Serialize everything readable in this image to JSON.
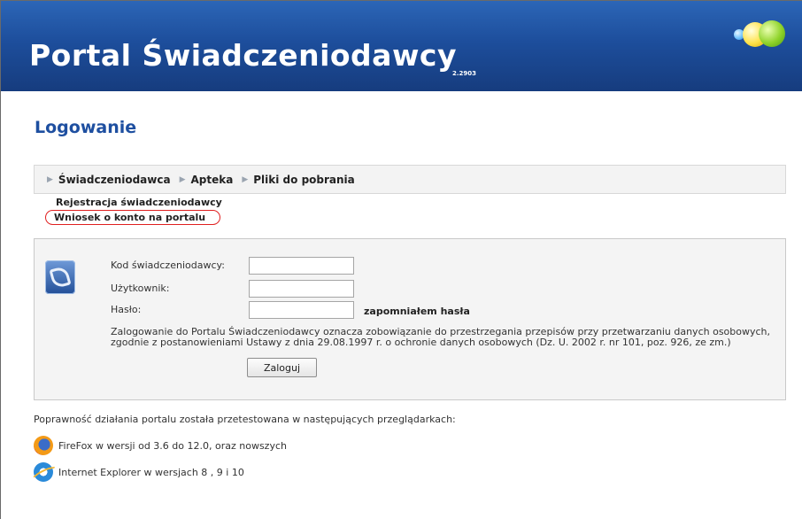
{
  "header": {
    "title": "Portal Świadczeniodawcy",
    "version": "2.2903"
  },
  "page": {
    "heading": "Logowanie"
  },
  "nav": {
    "items": [
      {
        "label": "Świadczeniodawca"
      },
      {
        "label": "Apteka"
      },
      {
        "label": "Pliki do pobrania"
      }
    ],
    "submenu": [
      {
        "label": "Rejestracja świadczeniodawcy"
      },
      {
        "label": "Wniosek o konto na portalu"
      }
    ]
  },
  "login": {
    "code_label": "Kod świadczeniodawcy:",
    "code_value": "",
    "user_label": "Użytkownik:",
    "user_value": "",
    "password_label": "Hasło:",
    "password_value": "",
    "forgot_label": "zapomniałem hasła",
    "legal_text": "Zalogowanie do Portalu Świadczeniodawcy oznacza zobowiązanie do przestrzegania przepisów przy przetwarzaniu danych osobowych, zgodnie z postanowieniami Ustawy z dnia 29.08.1997 r. o ochronie danych osobowych (Dz. U. 2002 r. nr 101, poz. 926, ze zm.)",
    "submit_label": "Zaloguj"
  },
  "browsers": {
    "intro": "Poprawność działania portalu została przetestowana w następujących przeglądarkach:",
    "items": [
      {
        "icon": "firefox-icon",
        "text": "FireFox w wersji od 3.6 do 12.0, oraz nowszych"
      },
      {
        "icon": "internet-explorer-icon",
        "text": "Internet Explorer w wersjach 8 , 9 i 10"
      }
    ]
  },
  "colors": {
    "header_blue": "#1d4e9c",
    "heading_blue": "#1e4fa0",
    "highlight_red": "#e02020"
  }
}
